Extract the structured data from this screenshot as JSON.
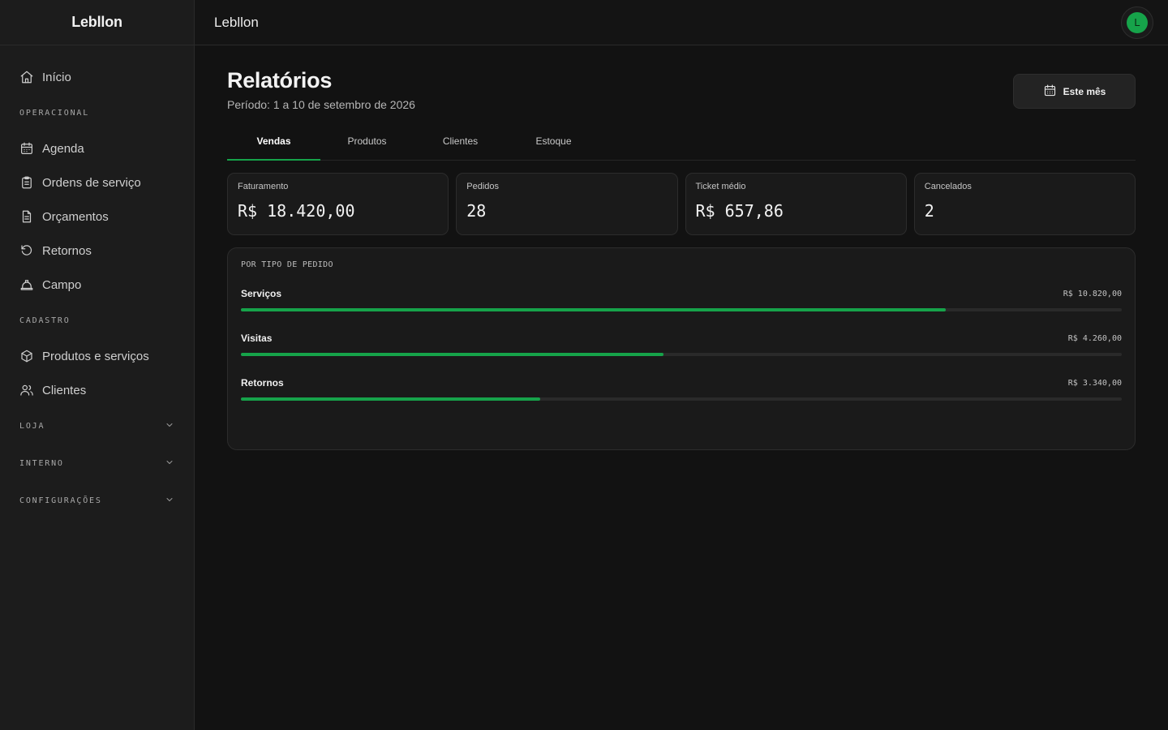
{
  "sidebar": {
    "brand": "Lebllon",
    "home": "Início",
    "sections": {
      "operacional": "OPERACIONAL",
      "cadastro": "CADASTRO",
      "loja": "LOJA",
      "interno": "INTERNO",
      "configuracoes": "CONFIGURAÇÕES"
    },
    "operacional_items": [
      "Agenda",
      "Ordens de serviço",
      "Orçamentos",
      "Retornos",
      "Campo"
    ],
    "cadastro_items": [
      "Produtos e serviços",
      "Clientes"
    ]
  },
  "topbar": {
    "title": "Lebllon",
    "avatar_initial": "L"
  },
  "page": {
    "title": "Relatórios",
    "subtitle": "Período: 1 a 10 de setembro de 2026",
    "period_button": "Este mês"
  },
  "tabs": [
    "Vendas",
    "Produtos",
    "Clientes",
    "Estoque"
  ],
  "active_tab": "Vendas",
  "kpis": [
    {
      "label": "Faturamento",
      "value": "R$ 18.420,00"
    },
    {
      "label": "Pedidos",
      "value": "28"
    },
    {
      "label": "Ticket médio",
      "value": "R$ 657,86"
    },
    {
      "label": "Cancelados",
      "value": "2"
    }
  ],
  "breakdown": {
    "title": "POR TIPO DE PEDIDO",
    "rows": [
      {
        "label": "Serviços",
        "value": "R$ 10.820,00",
        "fraction": 0.8
      },
      {
        "label": "Visitas",
        "value": "R$ 4.260,00",
        "fraction": 0.48
      },
      {
        "label": "Retornos",
        "value": "R$ 3.340,00",
        "fraction": 0.34
      }
    ]
  },
  "colors": {
    "accent": "#16a34a",
    "background": "#121212",
    "sidebar": "#1c1c1c",
    "card": "#1a1a1a"
  }
}
